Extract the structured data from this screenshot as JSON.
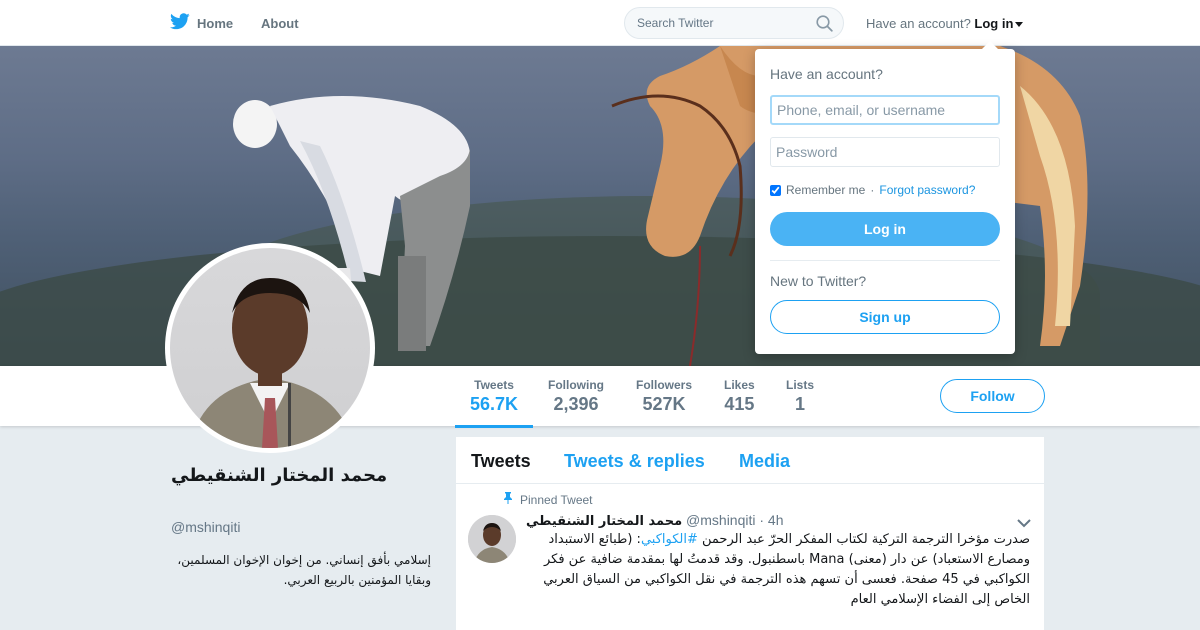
{
  "topbar": {
    "home_label": "Home",
    "about_label": "About",
    "search_placeholder": "Search Twitter",
    "have_account_text": "Have an account?",
    "login_label": "Log in"
  },
  "profile": {
    "name": "محمد المختار الشنقيطي",
    "handle": "@mshinqiti",
    "bio": "إسلامي بأفق إنساني. من إخوان الإخوان المسلمين، وبقايا المؤمنين بالربيع العربي."
  },
  "stats": [
    {
      "label": "Tweets",
      "value": "56.7K",
      "active": true
    },
    {
      "label": "Following",
      "value": "2,396"
    },
    {
      "label": "Followers",
      "value": "527K"
    },
    {
      "label": "Likes",
      "value": "415"
    },
    {
      "label": "Lists",
      "value": "1"
    }
  ],
  "follow_label": "Follow",
  "timeline": {
    "tabs": [
      "Tweets",
      "Tweets & replies",
      "Media"
    ],
    "pinned_label": "Pinned Tweet",
    "tweet": {
      "author": "محمد المختار الشنقيطي",
      "handle": "@mshinqiti",
      "time": "· 4h",
      "text_before": "صدرت مؤخرا الترجمة التركية لكتاب المفكر الحرّ عبد الرحمن ",
      "hashtag": "#الكواكبي",
      "text_after": ": (طبائع الاستبداد ومصارع الاستعباد) عن دار (معنى) Mana باسطنبول. وقد قدمتُ لها بمقدمة ضافية عن فكر الكواكبي في 45 صفحة. فعسى أن تسهم هذه الترجمة في نقل الكواكبي من السياق العربي الخاص إلى الفضاء الإسلامي العام"
    }
  },
  "login_dropdown": {
    "title": "Have an account?",
    "username_placeholder": "Phone, email, or username",
    "password_placeholder": "Password",
    "remember_label": "Remember me",
    "separator": "·",
    "forgot_label": "Forgot password?",
    "login_button": "Log in",
    "new_label": "New to Twitter?",
    "signup_button": "Sign up"
  },
  "colors": {
    "accent": "#1da1f2",
    "login_button": "#4ab3f4"
  },
  "icons": [
    "twitter-bird-icon",
    "home-icon",
    "search-icon",
    "caret-down-icon",
    "pin-icon",
    "chevron-down-icon"
  ]
}
